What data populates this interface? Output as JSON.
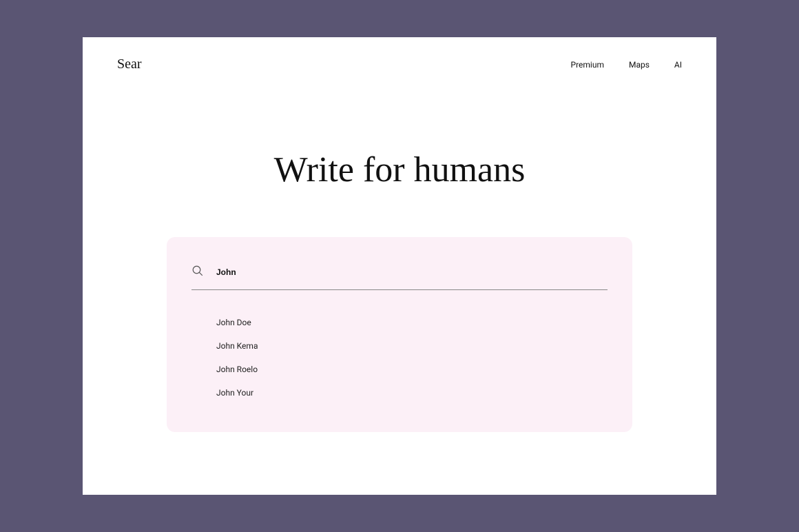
{
  "logo": "Sear",
  "nav": {
    "items": [
      {
        "label": "Premium"
      },
      {
        "label": "Maps"
      },
      {
        "label": "AI"
      }
    ]
  },
  "hero": {
    "title": "Write for humans"
  },
  "search": {
    "value": "John",
    "suggestions": [
      {
        "label": "John Doe"
      },
      {
        "label": "John Kema"
      },
      {
        "label": "John Roelo"
      },
      {
        "label": "John Your"
      }
    ]
  }
}
